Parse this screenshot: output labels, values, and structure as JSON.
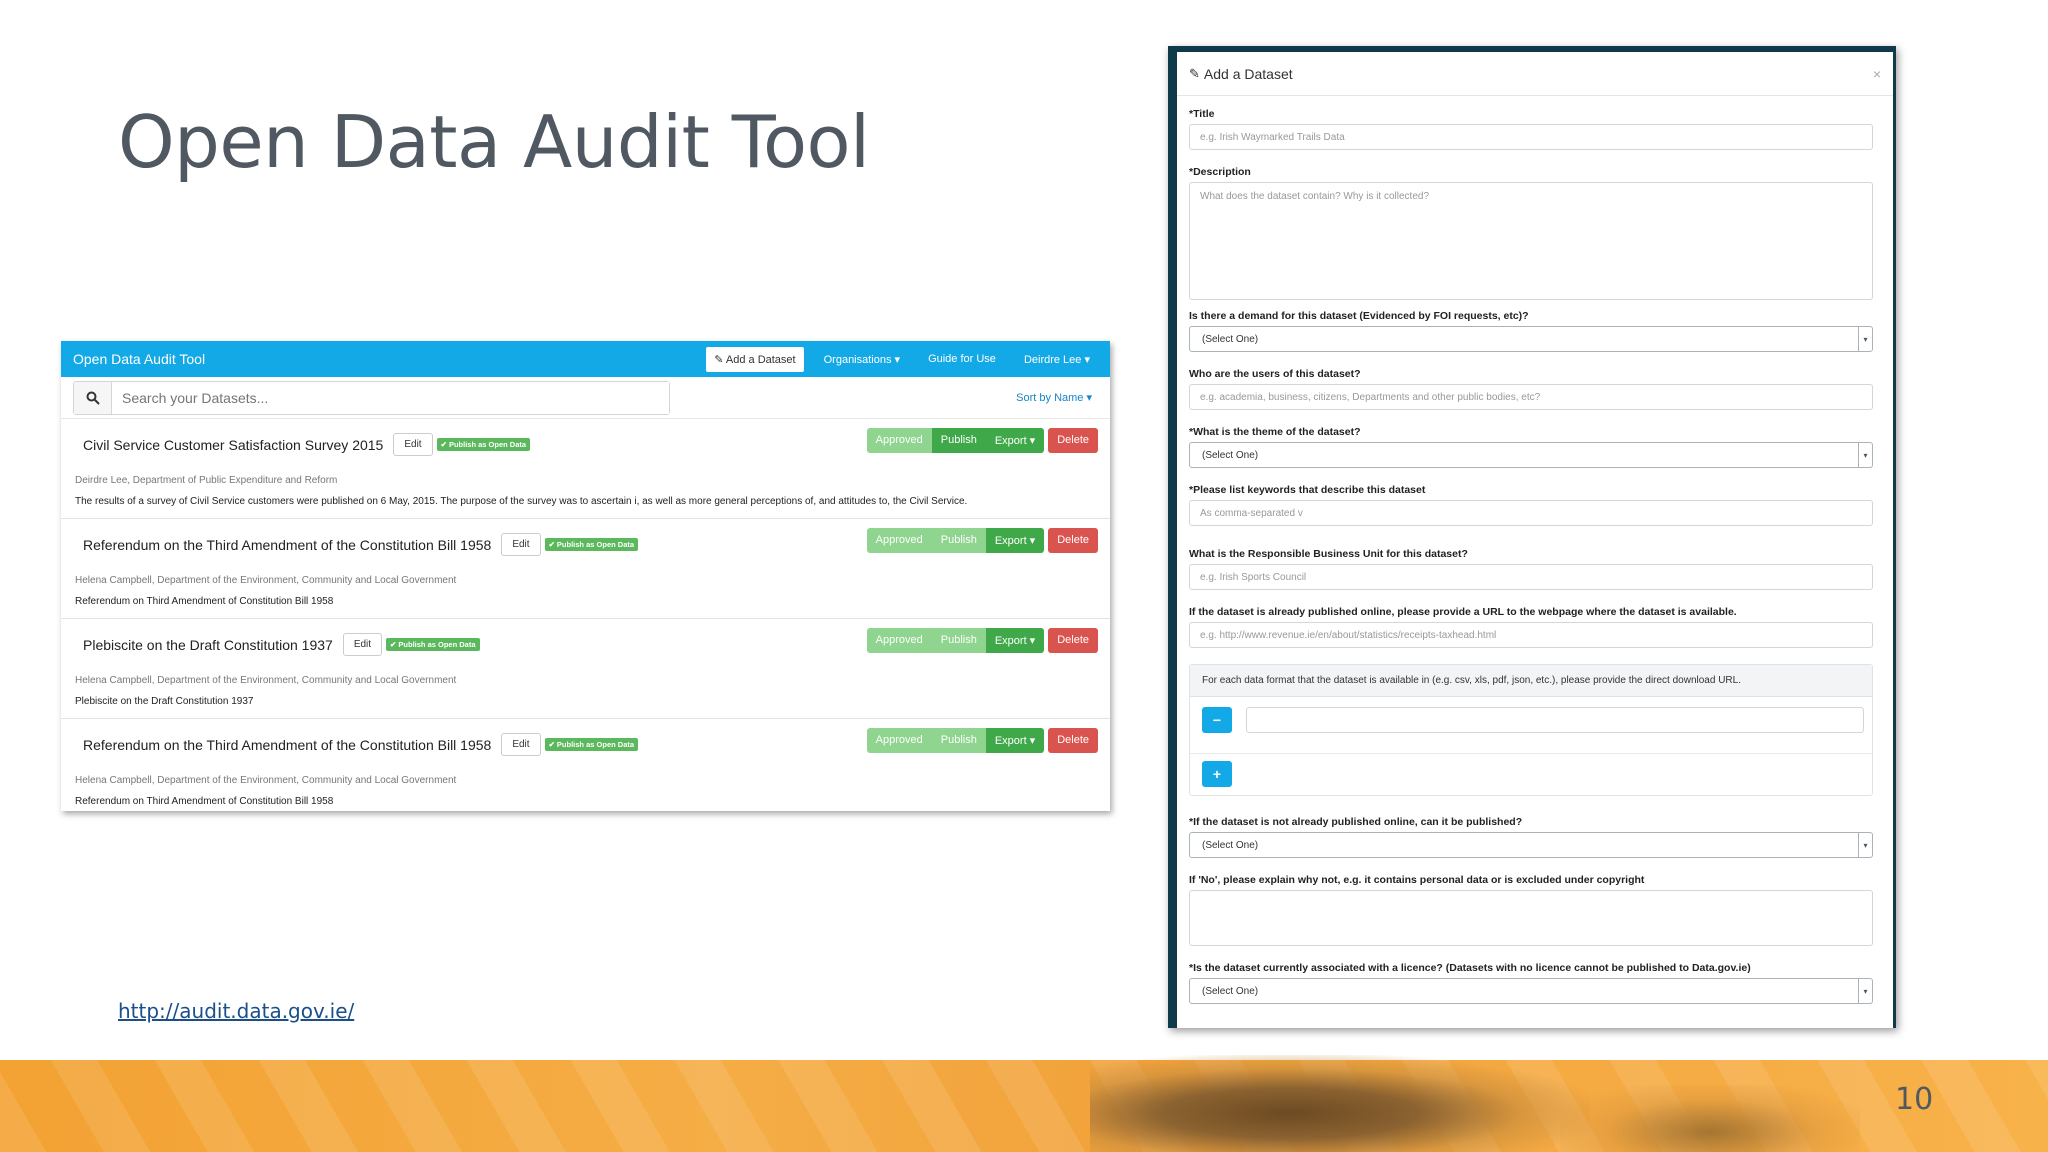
{
  "slide": {
    "title": "Open Data Audit Tool",
    "link": "http://audit.data.gov.ie/",
    "page_number": "10"
  },
  "app": {
    "brand": "Open Data Audit Tool",
    "nav": {
      "add_dataset": "Add a Dataset",
      "organisations": "Organisations ▾",
      "guide": "Guide for Use",
      "user": "Deirdre Lee ▾"
    },
    "search_placeholder": "Search your Datasets...",
    "sort": "Sort by Name ▾",
    "actions": {
      "edit": "Edit",
      "badge": "✔ Publish as Open Data",
      "approved": "Approved",
      "publish": "Publish",
      "export": "Export ▾",
      "delete": "Delete"
    },
    "datasets": [
      {
        "title": "Civil Service Customer Satisfaction Survey 2015",
        "owner": "Deirdre Lee, Department of Public Expenditure and Reform",
        "description": "The results of a survey of Civil Service customers were published on 6 May, 2015. The purpose of the survey was to ascertain i, as well as more general perceptions of, and attitudes to, the Civil Service."
      },
      {
        "title": "Referendum on the Third Amendment of the Constitution Bill 1958",
        "owner": "Helena Campbell, Department of the Environment, Community and Local Government",
        "description": "Referendum on Third Amendment of Constitution Bill 1958"
      },
      {
        "title": "Plebiscite on the Draft Constitution 1937",
        "owner": "Helena Campbell, Department of the Environment, Community and Local Government",
        "description": "Plebiscite on the Draft Constitution 1937"
      },
      {
        "title": "Referendum on the Third Amendment of the Constitution Bill 1958",
        "owner": "Helena Campbell, Department of the Environment, Community and Local Government",
        "description": "Referendum on Third Amendment of Constitution Bill 1958"
      }
    ]
  },
  "modal": {
    "title": "Add a Dataset",
    "close": "×",
    "fields": {
      "title_label": "*Title",
      "title_placeholder": "e.g. Irish Waymarked Trails Data",
      "description_label": "*Description",
      "description_placeholder": "What does the dataset contain? Why is it collected?",
      "demand_label": "Is there a demand for this dataset (Evidenced by FOI requests, etc)?",
      "select_one": "(Select One)",
      "users_label": "Who are the users of this dataset?",
      "users_placeholder": "e.g. academia, business, citizens, Departments and other public bodies, etc?",
      "theme_label": "*What is the theme of the dataset?",
      "keywords_label": "*Please list keywords that describe this dataset",
      "keywords_placeholder": "As comma-separated v",
      "unit_label": "What is the Responsible Business Unit for this dataset?",
      "unit_placeholder": "e.g. Irish Sports Council",
      "url_label": "If the dataset is already published online, please provide a URL to the webpage where the dataset is available.",
      "url_placeholder": "e.g. http://www.revenue.ie/en/about/statistics/receipts-taxhead.html",
      "formats_text": "For each data format that the dataset is available in (e.g. csv, xls, pdf, json, etc.), please provide the direct download URL.",
      "minus": "−",
      "plus": "+",
      "can_publish_label": "*If the dataset is not already published online, can it be published?",
      "explain_label": "If 'No', please explain why not, e.g. it contains personal data or is excluded under copyright",
      "licence_label": "*Is the dataset currently associated with a licence? (Datasets with no licence cannot be published to Data.gov.ie)"
    }
  }
}
